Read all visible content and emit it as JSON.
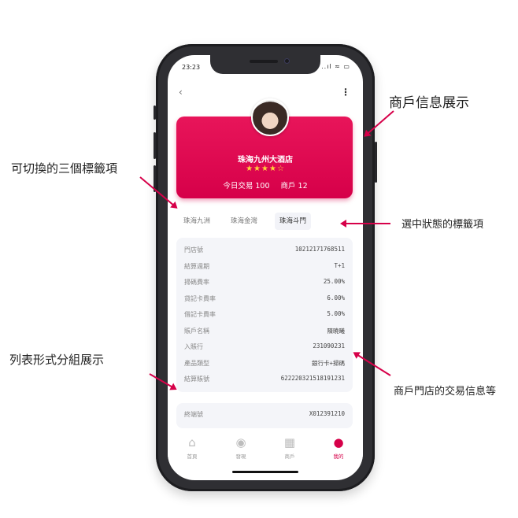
{
  "status": {
    "time": "23:23",
    "icons": "..ıl ≈ ▭"
  },
  "nav": {
    "back": "‹",
    "more": "⋮"
  },
  "merchant": {
    "name": "珠海九州大酒店",
    "rating_display": "★★★★☆",
    "rating": 4,
    "today_tx_label": "今日交易",
    "today_tx": "100",
    "merchants_label": "商戶",
    "merchants": "12"
  },
  "tabs": [
    {
      "label": "珠海九洲"
    },
    {
      "label": "珠海金灣"
    },
    {
      "label": "珠海斗門"
    }
  ],
  "info_rows": [
    {
      "label": "門店號",
      "value": "10212171768511"
    },
    {
      "label": "結算週期",
      "value": "T+1"
    },
    {
      "label": "掃碼費率",
      "value": "25.00%"
    },
    {
      "label": "貸記卡費率",
      "value": "6.00%"
    },
    {
      "label": "借記卡費率",
      "value": "5.00%"
    },
    {
      "label": "賬戶名稱",
      "value": "陳曉曦"
    },
    {
      "label": "入賬行",
      "value": "231090231"
    },
    {
      "label": "產品類型",
      "value": "銀行卡+掃碼"
    },
    {
      "label": "結算賬號",
      "value": "622220321518191231"
    }
  ],
  "extra_row": {
    "label": "終端號",
    "value": "X012391210"
  },
  "tabbar": [
    {
      "label": "首頁",
      "icon": "⌂"
    },
    {
      "label": "發現",
      "icon": "◉"
    },
    {
      "label": "商戶",
      "icon": "▦"
    },
    {
      "label": "我的",
      "icon": "●"
    }
  ],
  "callouts": {
    "merchant_info": "商戶信息展示",
    "three_tabs": "可切換的三個標籤項",
    "selected_tab": "選中狀態的標籤項",
    "list_group": "列表形式分組展示",
    "store_tx": "商戶門店的交易信息等"
  },
  "colors": {
    "accent": "#d60049",
    "panel": "#f4f5f9",
    "star": "#ffd23a"
  }
}
